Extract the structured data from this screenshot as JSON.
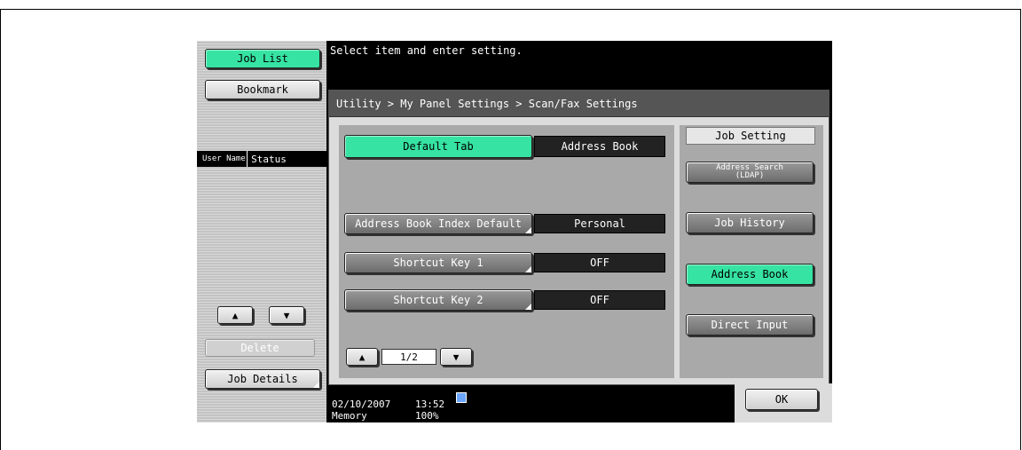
{
  "sidebar": {
    "job_list": "Job List",
    "bookmark": "Bookmark",
    "col_user_name": "User Name",
    "col_status": "Status",
    "delete": "Delete",
    "job_details": "Job Details"
  },
  "message": "Select item and enter setting.",
  "breadcrumb": "Utility > My Panel Settings > Scan/Fax Settings",
  "settings": {
    "default_tab_label": "Default Tab",
    "default_tab_value": "Address Book",
    "index_default_label": "Address Book Index Default",
    "index_default_value": "Personal",
    "shortcut1_label": "Shortcut Key 1",
    "shortcut1_value": "OFF",
    "shortcut2_label": "Shortcut Key 2",
    "shortcut2_value": "OFF"
  },
  "pager": {
    "page": "1/2"
  },
  "job_setting": {
    "title": "Job Setting",
    "address_search": "Address Search",
    "address_search_sub": "(LDAP)",
    "job_history": "Job History",
    "address_book": "Address Book",
    "direct_input": "Direct Input"
  },
  "status": {
    "date": "02/10/2007",
    "time": "13:52",
    "memory_label": "Memory",
    "memory_value": "100%"
  },
  "ok": "OK",
  "icons": {
    "up": "arrow-up-icon",
    "down": "arrow-down-icon",
    "network": "network-icon"
  },
  "colors": {
    "accent_green": "#36e3a3",
    "panel_gray": "#a9a9a9",
    "black": "#000000"
  }
}
